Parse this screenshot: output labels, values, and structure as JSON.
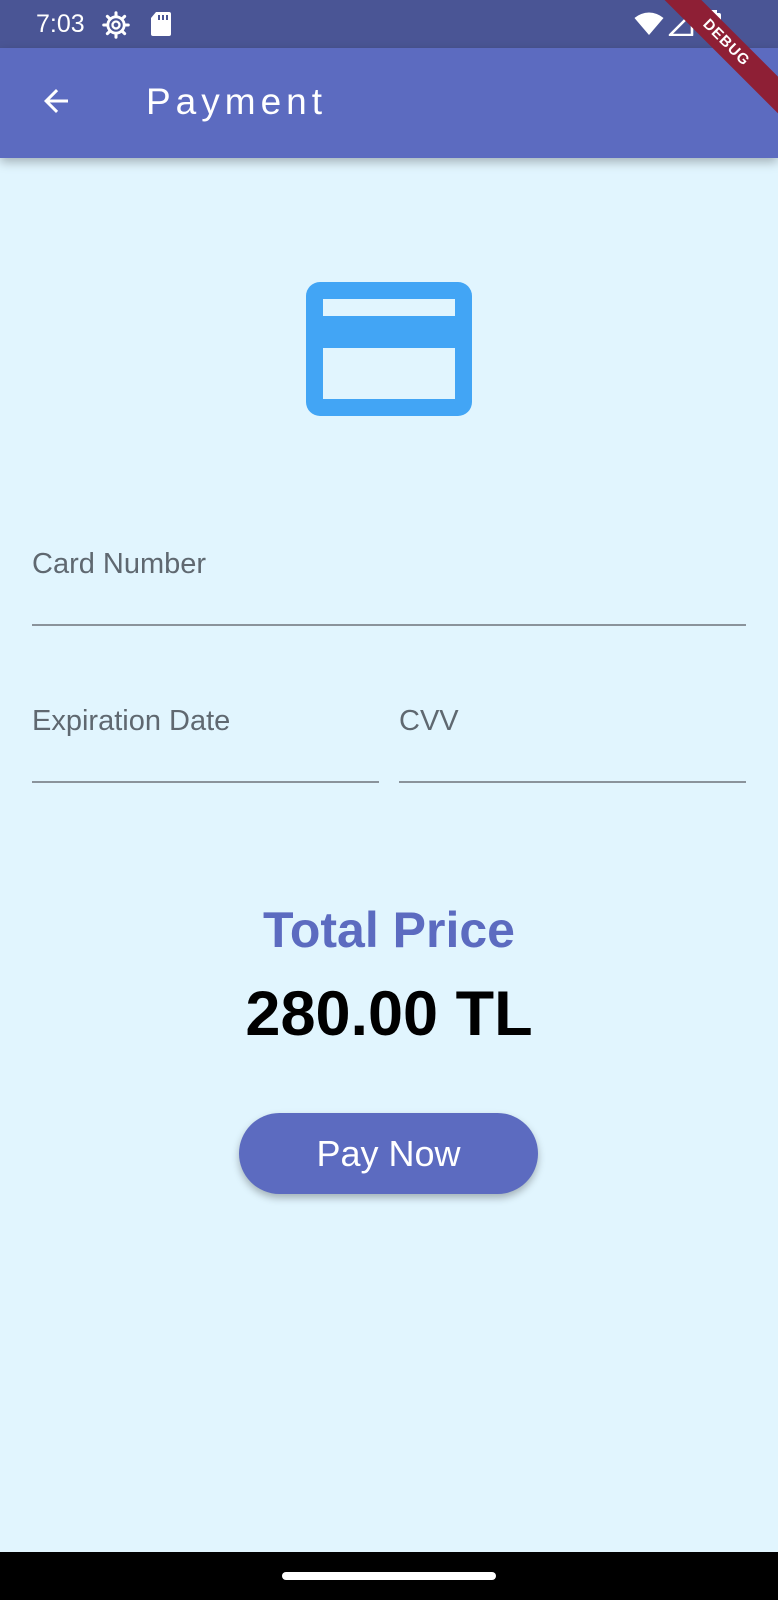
{
  "status_bar": {
    "time": "7:03",
    "icons": [
      "settings-icon",
      "sd-card-icon",
      "wifi-icon",
      "signal-icon",
      "battery-icon"
    ],
    "background": "#4A5595"
  },
  "app_bar": {
    "title": "Payment",
    "back_icon": "arrow-back-icon",
    "background": "#5C6BC0",
    "debug_label": "DEBUG"
  },
  "card_icon": {
    "name": "credit-card-icon",
    "color": "#42A5F5"
  },
  "form": {
    "card_number": {
      "label": "Card Number",
      "value": ""
    },
    "expiration_date": {
      "label": "Expiration Date",
      "value": ""
    },
    "cvv": {
      "label": "CVV",
      "value": ""
    }
  },
  "total": {
    "label": "Total Price",
    "value": "280.00 TL",
    "label_color": "#5C6BC0"
  },
  "pay_button": {
    "label": "Pay Now",
    "color": "#5C6BC0"
  },
  "background": "#E1F5FE"
}
